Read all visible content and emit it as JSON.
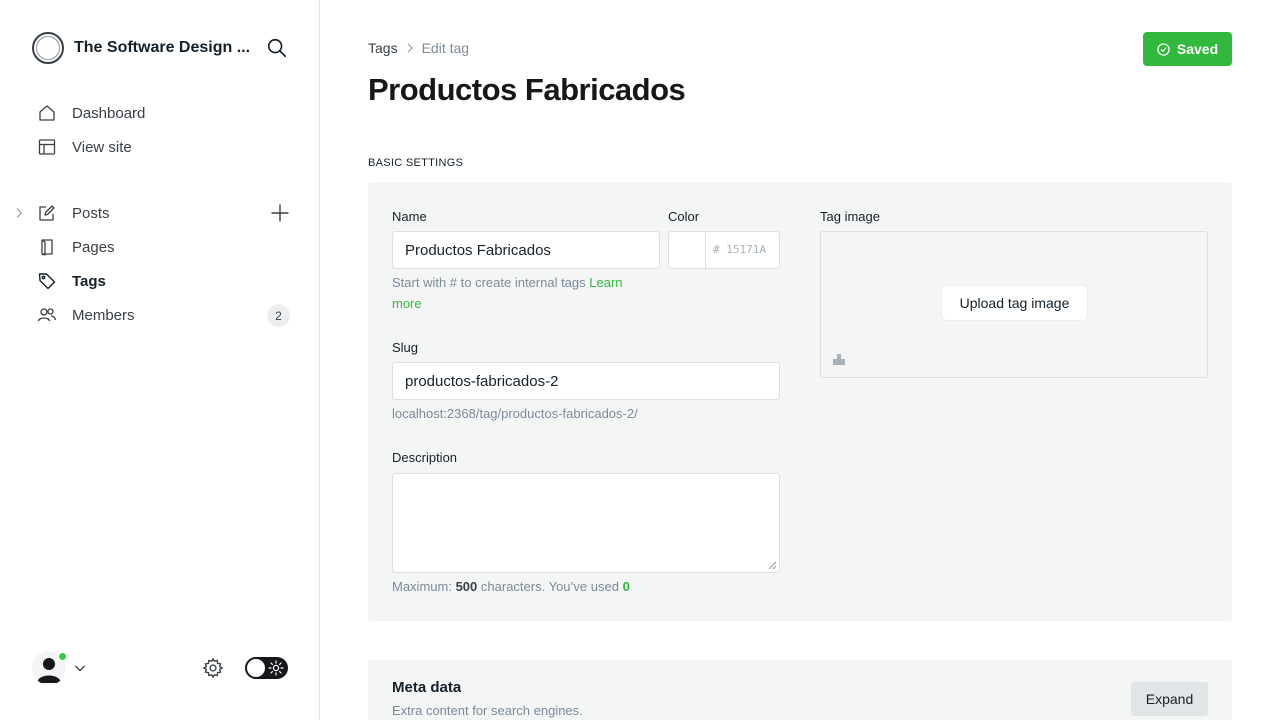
{
  "brand": {
    "title": "The Software Design ..."
  },
  "nav": {
    "dashboard": "Dashboard",
    "view_site": "View site",
    "posts": "Posts",
    "pages": "Pages",
    "tags": "Tags",
    "members": "Members",
    "members_count": "2"
  },
  "breadcrumb": {
    "parent": "Tags",
    "current": "Edit tag"
  },
  "page": {
    "title": "Productos Fabricados"
  },
  "status": {
    "saved_label": "Saved",
    "accent": "#30b93c"
  },
  "basic": {
    "section_title": "BASIC SETTINGS",
    "name_label": "Name",
    "name_value": "Productos Fabricados",
    "name_hint": "Start with # to create internal tags",
    "name_hint_link_1": "Learn",
    "name_hint_link_2": "more",
    "color_label": "Color",
    "color_value": "# 15171A",
    "slug_label": "Slug",
    "slug_value": "productos-fabricados-2",
    "slug_url": "localhost:2368/tag/productos-fabricados-2/",
    "description_label": "Description",
    "description_value": "",
    "desc_hint_prefix": "Maximum:",
    "desc_hint_max": "500",
    "desc_hint_mid": "characters. You’ve used",
    "desc_hint_used": "0",
    "tag_image_label": "Tag image",
    "upload_label": "Upload tag image"
  },
  "meta": {
    "title": "Meta data",
    "subtitle": "Extra content for search engines.",
    "expand_label": "Expand"
  }
}
